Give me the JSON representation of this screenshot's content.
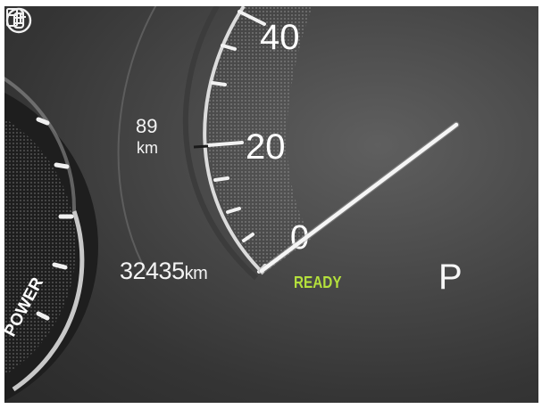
{
  "speedometer": {
    "tick_labels": [
      "0",
      "20",
      "40"
    ],
    "needle_reading": 0
  },
  "range": {
    "value": "89",
    "unit": "km",
    "icon": "fuel-pump-icon"
  },
  "odometer": {
    "value": "32435",
    "unit": "km"
  },
  "power_meter": {
    "label": "POWER"
  },
  "status": {
    "ready": "READY",
    "ready_color": "#b4e03c",
    "vehicle_mode_icon": "ev-system-icon"
  },
  "gear": "P"
}
